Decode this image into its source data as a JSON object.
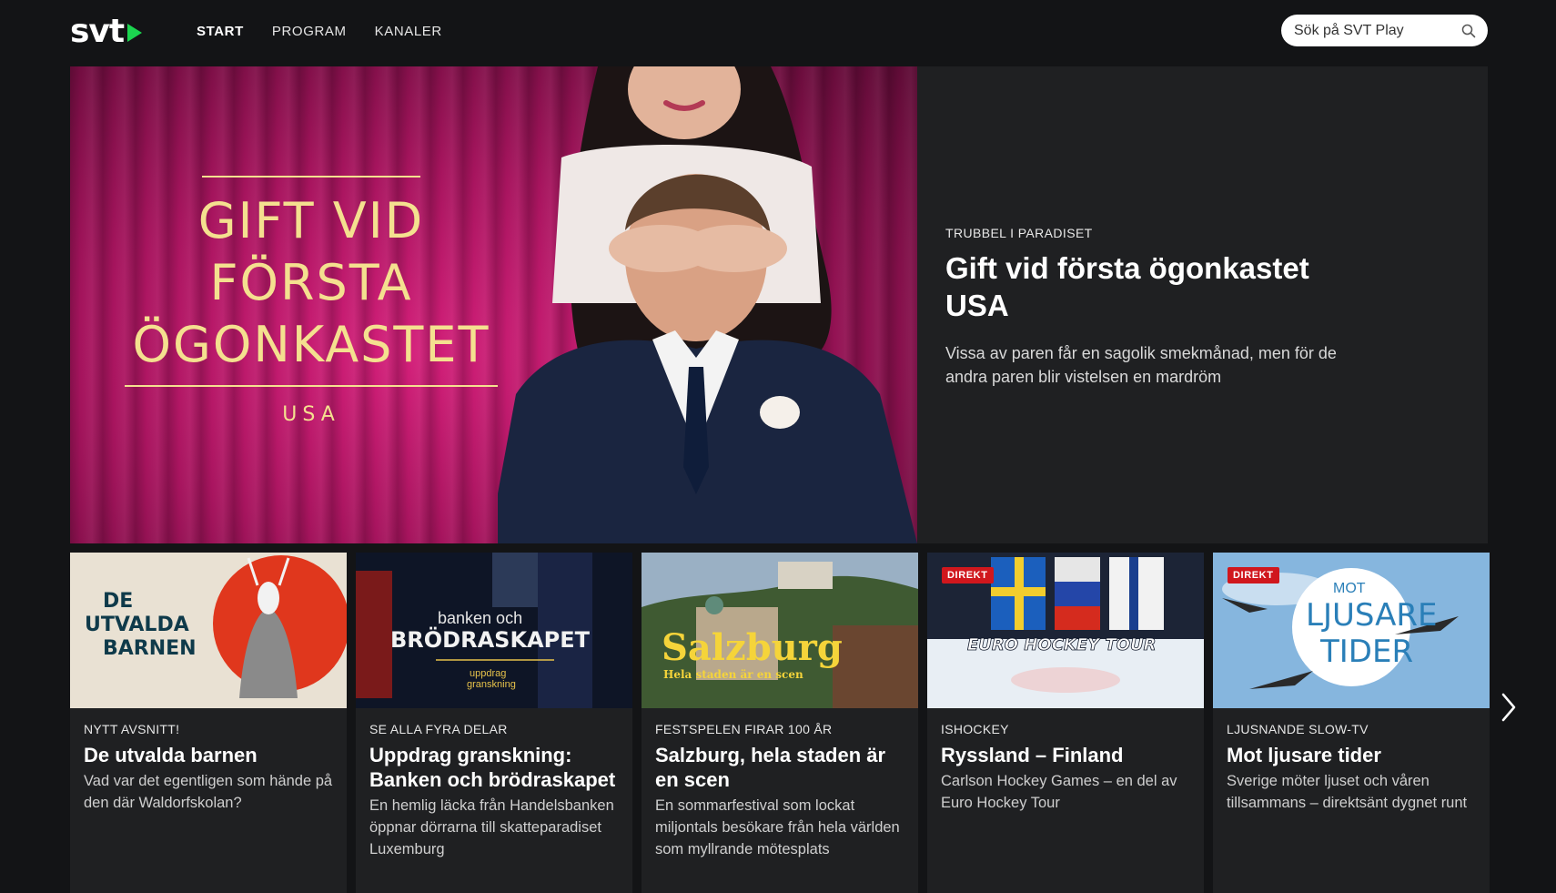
{
  "header": {
    "logo_text": "svt",
    "nav": [
      {
        "label": "START",
        "active": true
      },
      {
        "label": "PROGRAM",
        "active": false
      },
      {
        "label": "KANALER",
        "active": false
      }
    ],
    "search": {
      "placeholder": "Sök på SVT Play",
      "icon": "search-icon"
    }
  },
  "hero": {
    "image_title": "GIFT VID FÖRSTA ÖGONKASTET",
    "image_subtitle": "USA",
    "kicker": "TRUBBEL I PARADISET",
    "title": "Gift vid första ögonkastet USA",
    "description": "Vissa av paren får en sagolik smekmånad, men för de andra paren blir vistelsen en mardröm"
  },
  "cards": [
    {
      "kicker": "NYTT AVSNITT!",
      "title": "De utvalda barnen",
      "description": "Vad var det egentligen som hände på den där Waldorfskolan?",
      "thumb_text": "DE UTVALDA BARNEN",
      "badge": null
    },
    {
      "kicker": "SE ALLA FYRA DELAR",
      "title": "Uppdrag granskning: Banken och brödraskapet",
      "description": "En hemlig läcka från Handelsbanken öppnar dörrarna till skatteparadiset Luxemburg",
      "thumb_text_top": "banken och",
      "thumb_text": "BRÖDRASKAPET",
      "thumb_text_sub": "uppdrag granskning",
      "badge": null
    },
    {
      "kicker": "FESTSPELEN FIRAR 100 ÅR",
      "title": "Salzburg, hela staden är en scen",
      "description": "En sommarfestival som lockat miljontals besökare från hela världen som myllrande mötesplats",
      "thumb_text": "Salzburg",
      "thumb_text_sub": "Hela staden är en scen",
      "badge": null
    },
    {
      "kicker": "ISHOCKEY",
      "title": "Ryssland – Finland",
      "description": "Carlson Hockey Games – en del av Euro Hockey Tour",
      "thumb_text": "EURO HOCKEY TOUR",
      "badge": "DIREKT"
    },
    {
      "kicker": "LJUSNANDE SLOW-TV",
      "title": "Mot ljusare tider",
      "description": "Sverige möter ljuset och våren tillsammans – direktsänt dygnet runt",
      "thumb_text_top": "MOT",
      "thumb_text": "LJUSARE TIDER",
      "badge": "DIREKT"
    }
  ],
  "colors": {
    "background": "#131416",
    "panel": "#1f2022",
    "brand_green": "#1bd54f",
    "live_red": "#d0171d",
    "hero_gold": "#f4e08f"
  }
}
